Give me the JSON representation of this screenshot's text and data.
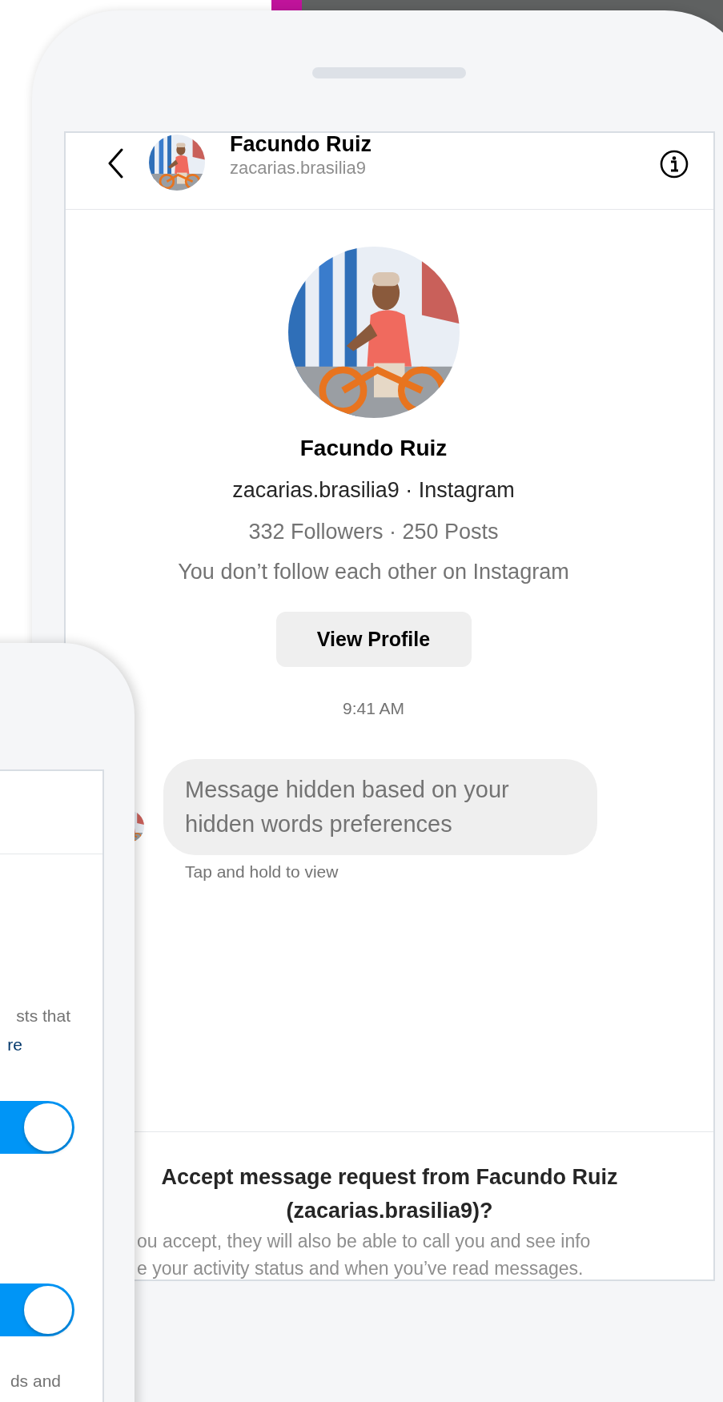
{
  "conversation": {
    "header": {
      "name": "Facundo Ruiz",
      "username": "zacarias.brasilia9"
    },
    "profile": {
      "name": "Facundo Ruiz",
      "subtitle": "zacarias.brasilia9 · Instagram",
      "stats": "332 Followers · 250 Posts",
      "relationship": "You don’t follow each other on Instagram",
      "button": "View Profile"
    },
    "timestamp": "9:41 AM",
    "messages": [
      {
        "text": "Message hidden based on your hidden words preferences",
        "hint": "Tap and hold to view"
      }
    ],
    "request": {
      "title": "Accept message request from Facundo Ruiz (zacarias.brasilia9)?",
      "description_lines": [
        "ou accept, they will also be able to call you and see info",
        "e your activity status and when you’ve read messages."
      ]
    }
  },
  "settings_screen": {
    "items": [
      {
        "kind": "text",
        "text": "sts that"
      },
      {
        "kind": "link",
        "text": "re"
      },
      {
        "kind": "toggle",
        "on": true
      },
      {
        "kind": "toggle",
        "on": true
      },
      {
        "kind": "text",
        "text": "ds and"
      }
    ]
  }
}
